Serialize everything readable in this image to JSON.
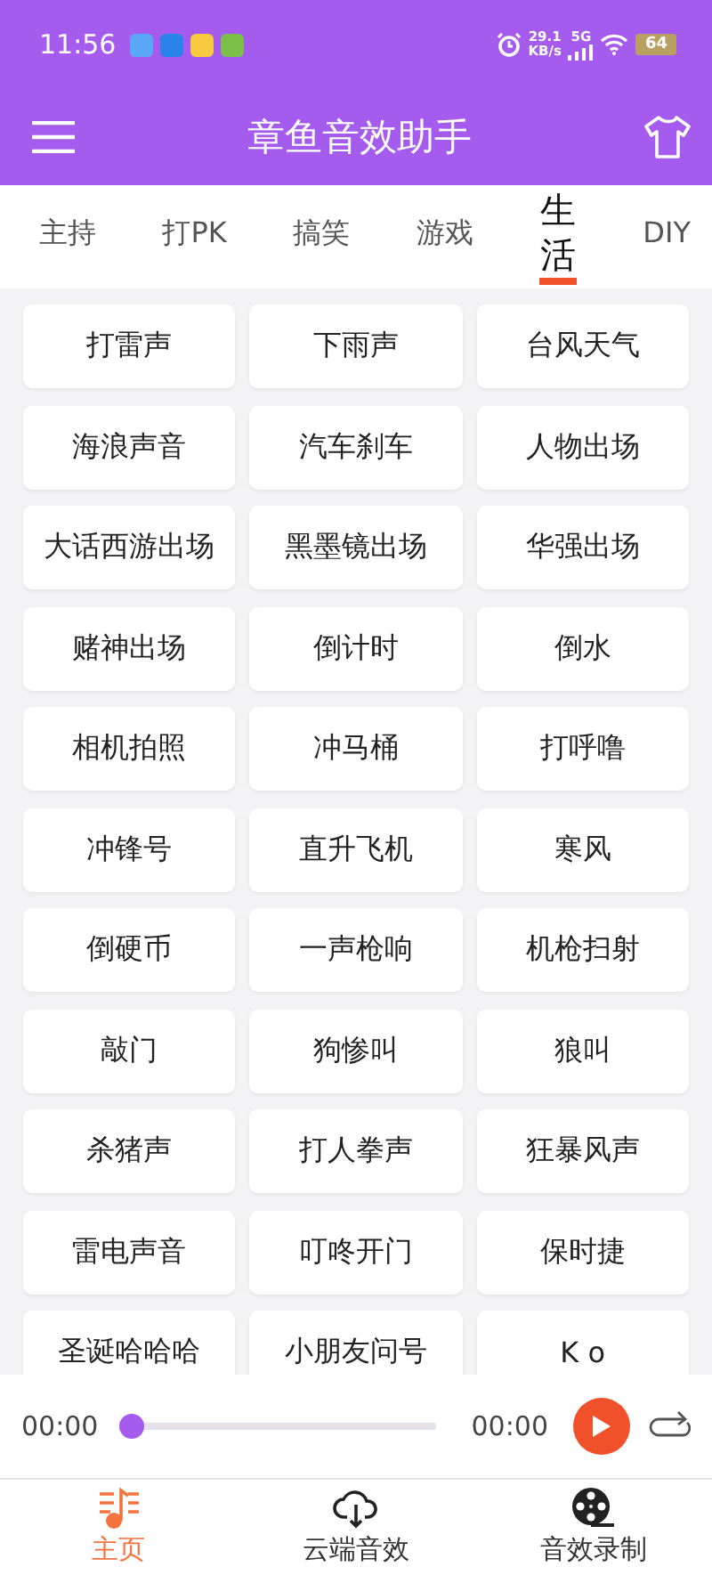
{
  "status_bar": {
    "time": "11:56",
    "net_speed": "29.1",
    "net_unit": "KB/s",
    "network": "5G",
    "battery": "64"
  },
  "header": {
    "title": "章鱼音效助手"
  },
  "tabs": [
    {
      "label": "主持",
      "selected": false
    },
    {
      "label": "打PK",
      "selected": false
    },
    {
      "label": "搞笑",
      "selected": false
    },
    {
      "label": "游戏",
      "selected": false
    },
    {
      "label": "生活",
      "selected": true
    },
    {
      "label": "DIY",
      "selected": false
    }
  ],
  "sounds": [
    "打雷声",
    "下雨声",
    "台风天气",
    "海浪声音",
    "汽车刹车",
    "人物出场",
    "大话西游出场",
    "黑墨镜出场",
    "华强出场",
    "赌神出场",
    "倒计时",
    "倒水",
    "相机拍照",
    "冲马桶",
    "打呼噜",
    "冲锋号",
    "直升飞机",
    "寒风",
    "倒硬币",
    "一声枪响",
    "机枪扫射",
    "敲门",
    "狗惨叫",
    "狼叫",
    "杀猪声",
    "打人拳声",
    "狂暴风声",
    "雷电声音",
    "叮咚开门",
    "保时捷",
    "圣诞哈哈哈",
    "小朋友问号",
    "K o"
  ],
  "player": {
    "elapsed": "00:00",
    "duration": "00:00",
    "level": 0
  },
  "bottom_nav": [
    {
      "label": "主页",
      "kind": "home",
      "selected": true
    },
    {
      "label": "云端音效",
      "kind": "cloud",
      "selected": false
    },
    {
      "label": "音效录制",
      "kind": "record",
      "selected": false
    }
  ]
}
